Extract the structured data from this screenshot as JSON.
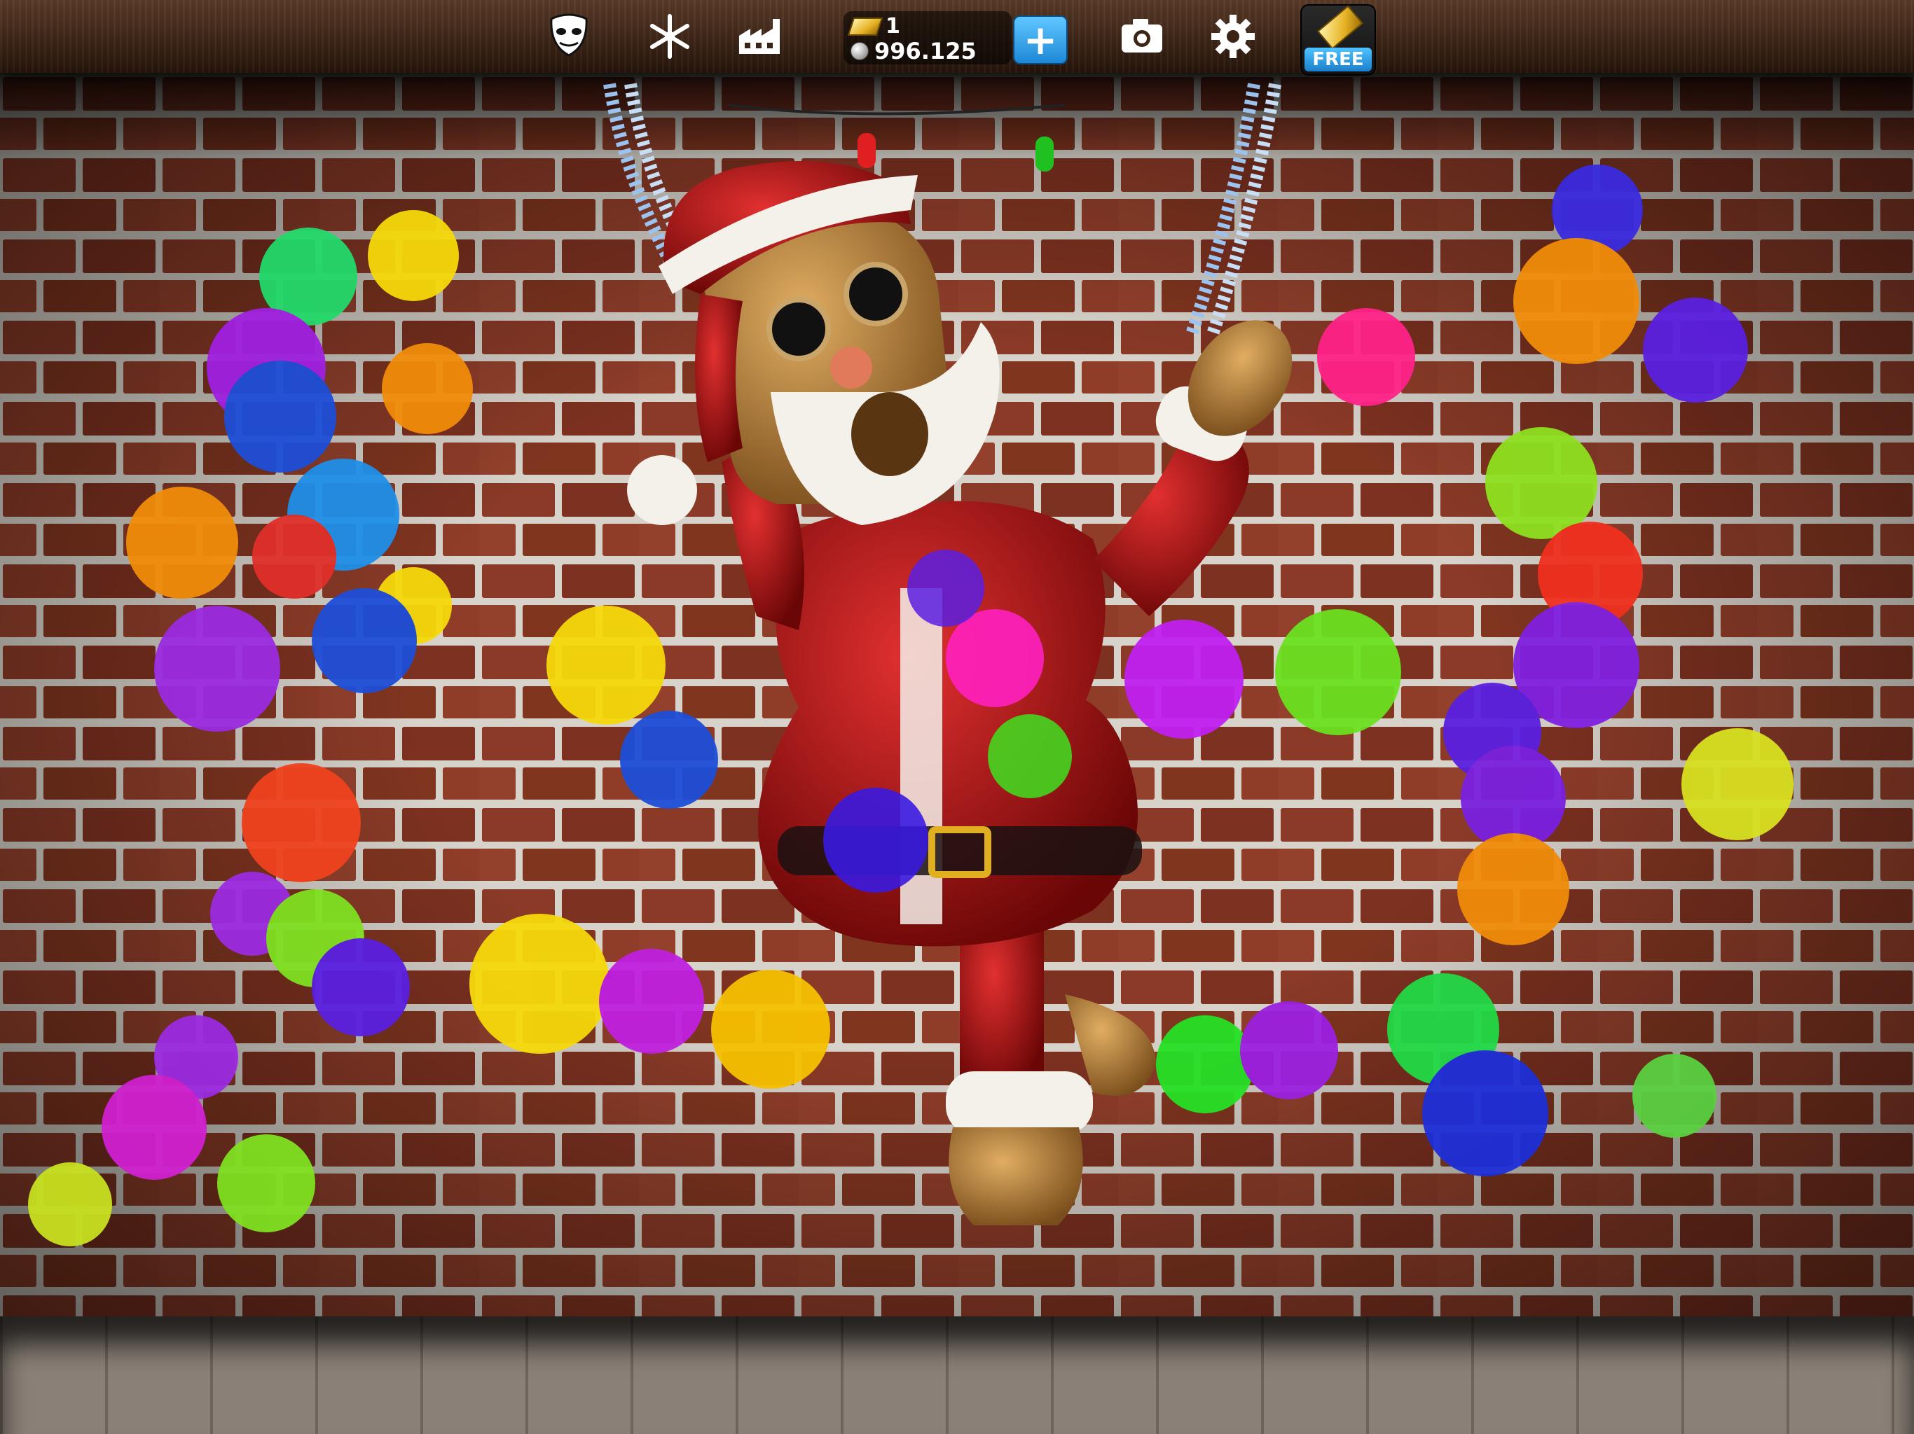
{
  "toolbar": {
    "buttons": [
      {
        "name": "mask-icon",
        "label": ""
      },
      {
        "name": "snowflake-icon",
        "label": ""
      },
      {
        "name": "factory-icon",
        "label": ""
      }
    ],
    "gold_count": "1",
    "silver_count": "996.125",
    "add_label": "+",
    "free_label": "FREE"
  },
  "scene": {
    "character": "santa-ragdoll",
    "colors": {
      "brick": "#8e3b28",
      "mortar": "#d9d4cc",
      "santa_red": "#b01414",
      "fur": "#f4f0ea",
      "wood": "#b07a3a"
    }
  }
}
